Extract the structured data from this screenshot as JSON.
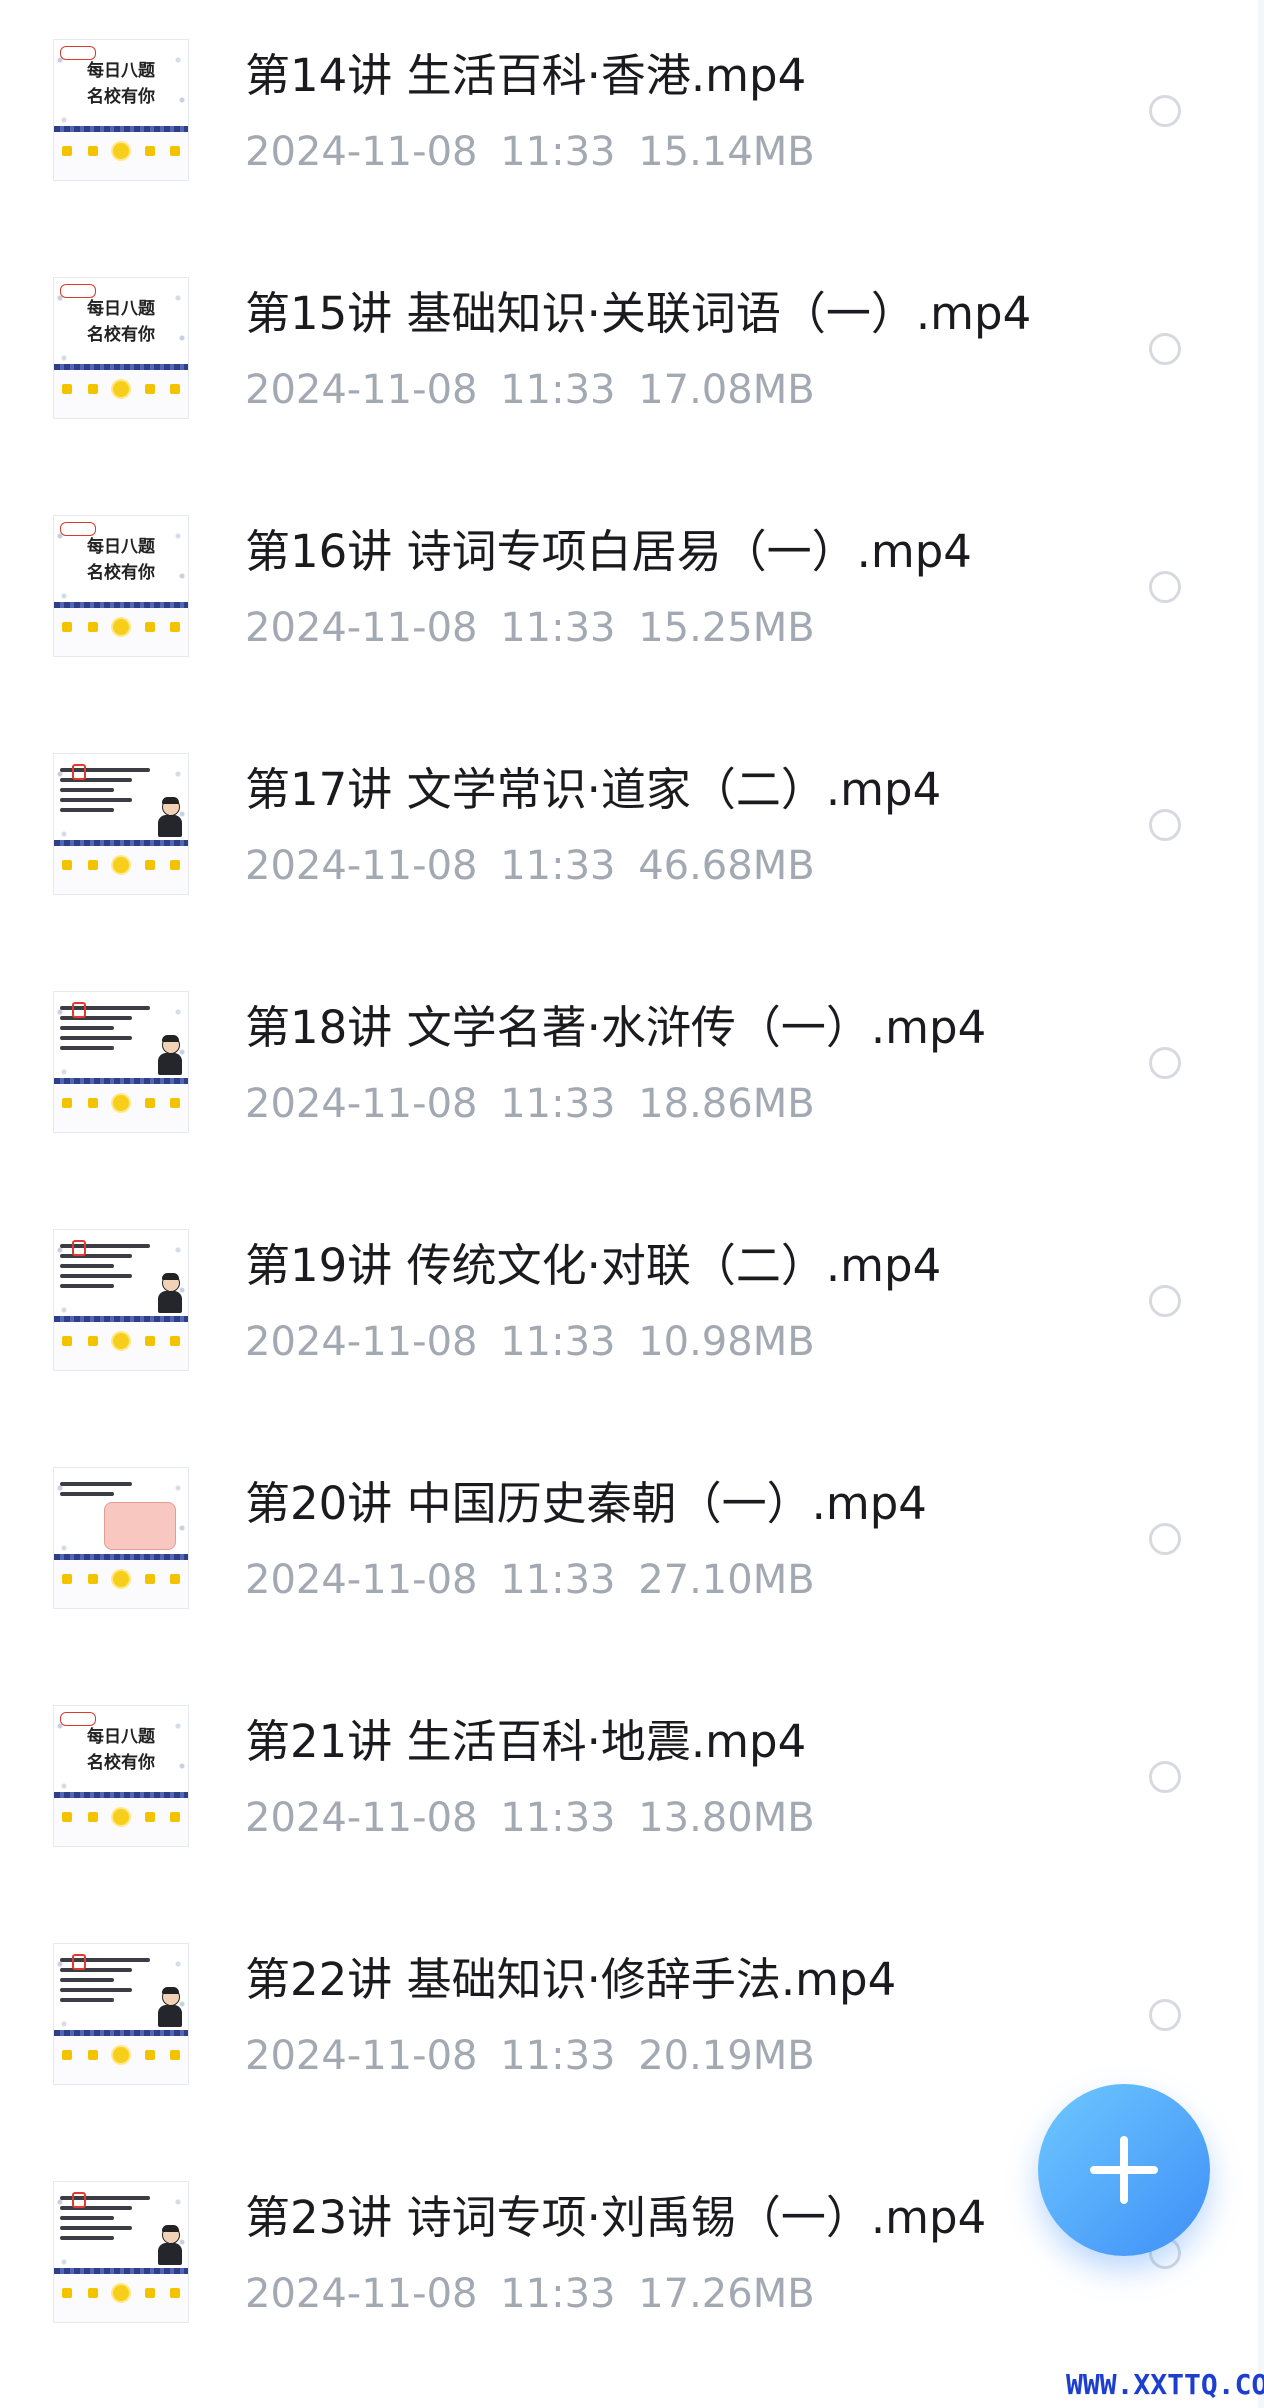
{
  "files": [
    {
      "title": "第14讲 生活百科·香港.mp4",
      "date": "2024-11-08",
      "time": "11:33",
      "size": "15.14MB",
      "thumb": {
        "kind": "cover",
        "line1": "每日八题",
        "line2": "名校有你"
      }
    },
    {
      "title": "第15讲 基础知识·关联词语（一）.mp4",
      "date": "2024-11-08",
      "time": "11:33",
      "size": "17.08MB",
      "thumb": {
        "kind": "cover",
        "line1": "每日八题",
        "line2": "名校有你"
      }
    },
    {
      "title": "第16讲 诗词专项白居易（一）.mp4",
      "date": "2024-11-08",
      "time": "11:33",
      "size": "15.25MB",
      "thumb": {
        "kind": "cover",
        "line1": "每日八题",
        "line2": "名校有你"
      }
    },
    {
      "title": "第17讲 文学常识·道家（二）.mp4",
      "date": "2024-11-08",
      "time": "11:33",
      "size": "46.68MB",
      "thumb": {
        "kind": "question"
      }
    },
    {
      "title": "第18讲 文学名著·水浒传（一）.mp4",
      "date": "2024-11-08",
      "time": "11:33",
      "size": "18.86MB",
      "thumb": {
        "kind": "question"
      }
    },
    {
      "title": "第19讲 传统文化·对联（二）.mp4",
      "date": "2024-11-08",
      "time": "11:33",
      "size": "10.98MB",
      "thumb": {
        "kind": "question"
      }
    },
    {
      "title": "第20讲 中国历史秦朝（一）.mp4",
      "date": "2024-11-08",
      "time": "11:33",
      "size": "27.10MB",
      "thumb": {
        "kind": "map"
      }
    },
    {
      "title": "第21讲 生活百科·地震.mp4",
      "date": "2024-11-08",
      "time": "11:33",
      "size": "13.80MB",
      "thumb": {
        "kind": "cover",
        "line1": "每日八题",
        "line2": "名校有你"
      }
    },
    {
      "title": "第22讲 基础知识·修辞手法.mp4",
      "date": "2024-11-08",
      "time": "11:33",
      "size": "20.19MB",
      "thumb": {
        "kind": "question"
      }
    },
    {
      "title": "第23讲 诗词专项·刘禹锡（一）.mp4",
      "date": "2024-11-08",
      "time": "11:33",
      "size": "17.26MB",
      "thumb": {
        "kind": "question"
      }
    }
  ],
  "fab": {
    "icon": "plus-icon"
  },
  "watermark": "WWW.XXTTQ.COM",
  "colors": {
    "title": "#1b1b1f",
    "meta": "#a3a9b2",
    "radio_border": "#d6dae0",
    "fab_start": "#6ec8ff",
    "fab_end": "#3f8ff7",
    "watermark": "#1c3fd0"
  }
}
